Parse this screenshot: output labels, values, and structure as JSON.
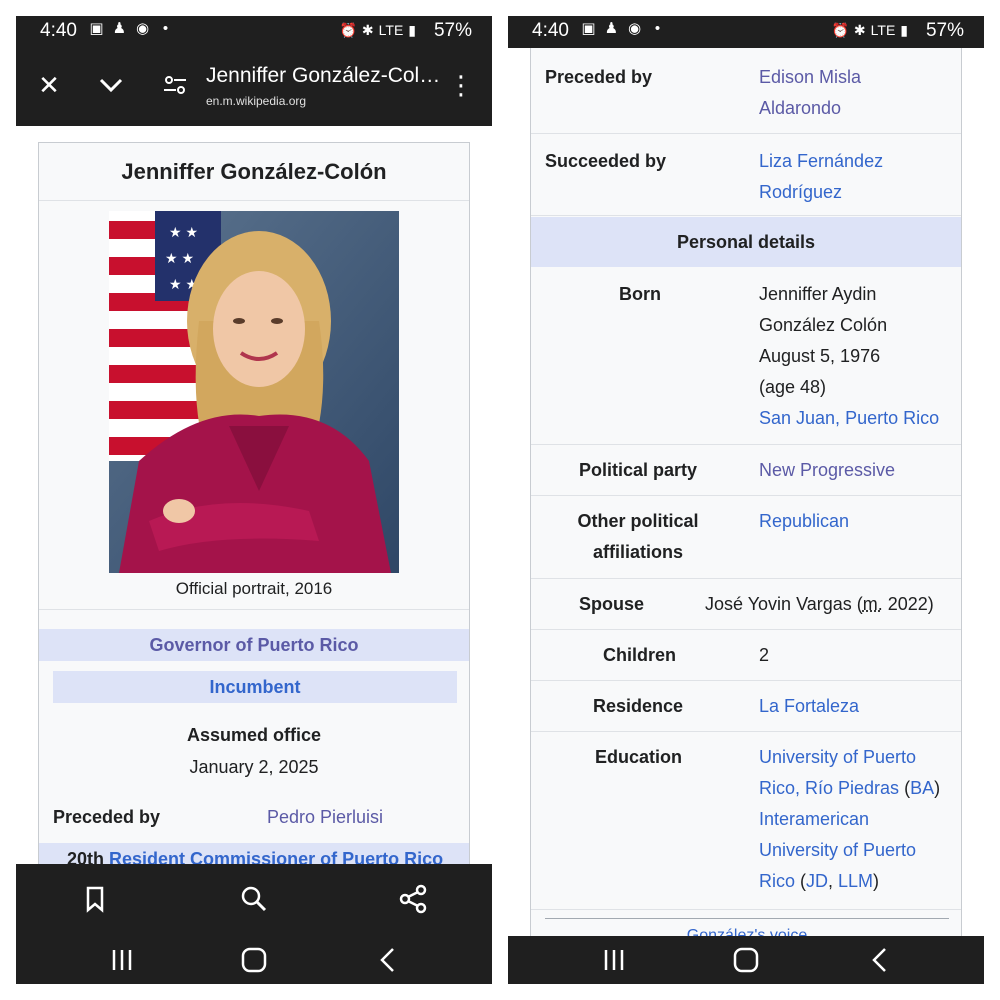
{
  "status": {
    "time": "4:40",
    "battery": "57%",
    "network": "LTE"
  },
  "browser": {
    "title": "Jenniffer González-Col…",
    "url": "en.m.wikipedia.org"
  },
  "infobox": {
    "name": "Jenniffer González-Colón",
    "caption": "Official portrait, 2016",
    "office": "Governor of Puerto Rico",
    "incumbent": "Incumbent",
    "assumed_label": "Assumed office",
    "assumed_date": "January 2, 2025",
    "preceded_label": "Preceded by",
    "preceded_value": "Pedro Pierluisi",
    "next_office_prefix": "20th",
    "next_office": "Resident Commissioner of Puerto Rico"
  },
  "right": {
    "preceded_label": "Preceded by",
    "preceded_line1": "Edison Misla",
    "preceded_line2": "Aldarondo",
    "succeeded_label": "Succeeded by",
    "succeeded_line1": "Liza Fernández",
    "succeeded_line2": "Rodríguez",
    "personal_header": "Personal details",
    "born_label": "Born",
    "born_line1": "Jenniffer Aydin",
    "born_line2": "González Colón",
    "born_line3": "August 5, 1976",
    "born_line4": "(age 48)",
    "born_place": "San Juan, Puerto Rico",
    "party_label": "Political party",
    "party_value": "New Progressive",
    "other_label_line1": "Other political",
    "other_label_line2": "affiliations",
    "other_value": "Republican",
    "spouse_label": "Spouse",
    "spouse_name": "José Yovin Vargas (",
    "spouse_m": "m.",
    "spouse_year": " 2022)",
    "children_label": "Children",
    "children_value": "2",
    "residence_label": "Residence",
    "residence_value": "La Fortaleza",
    "education_label": "Education",
    "edu_line1": "University of Puerto",
    "edu_line2a": "Rico, Río Piedras",
    "edu_line2b": " (",
    "edu_line2c": "BA",
    "edu_line2d": ")",
    "edu_line3": "Interamerican",
    "edu_line4": "University of Puerto",
    "edu_line5a": "Rico",
    "edu_line5b": " (",
    "edu_line5c": "JD",
    "edu_line5d": ", ",
    "edu_line5e": "LLM",
    "edu_line5f": ")",
    "voice_hint": "González's voice"
  },
  "colors": {
    "bar": "#1f1f1f",
    "header_bg": "#dde3f7",
    "link": "#3366cc",
    "visited_link": "#5b5aa6"
  }
}
